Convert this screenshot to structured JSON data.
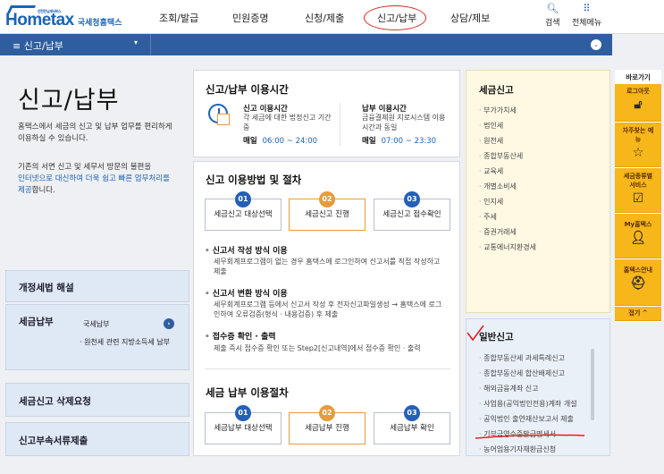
{
  "header": {
    "logo_main": "Hometax",
    "logo_small": "안전한 납세서비스",
    "logo_sub": "국세청홈택스",
    "nav": [
      "조회/발급",
      "민원증명",
      "신청/제출",
      "신고/납부",
      "상담/제보"
    ],
    "search_label": "검색",
    "all_menu_label": "전체메뉴"
  },
  "navstrip": {
    "menu_label": "≡  신고/납부"
  },
  "left": {
    "title": "신고/납부",
    "desc1": "홈택스에서 세금의 신고 및 납부 업무를 편리하게 이용하실 수 있습니다.",
    "desc2_pre": "기존의 서면 신고 및 세무서 방문의 불편을",
    "desc2_link": "인터넷으로 대신하여 더욱 쉽고 빠른 업무처리를 제공",
    "desc2_post": "합니다.",
    "boxes": {
      "tax_law": "개정세법 해설",
      "tax_payment": "세금납부",
      "national_tax_payment": "국세납부",
      "withholding_local_tax": "· 원천세 관련 지방소득세 납부",
      "delete_request": "세금신고 삭제요청",
      "attach_docs": "신고부속서류제출"
    }
  },
  "usage_time": {
    "title": "신고/납부 이용시간",
    "filing_title": "신고 이용시간",
    "filing_desc": "각 세금에 대한 법정신고 기간 중",
    "filing_daily": "매일",
    "filing_time": "06:00 ~ 24:00",
    "payment_title": "납부 이용시간",
    "payment_desc": "금융결제원 지로시스템 이용시간과 동일",
    "payment_daily": "매일",
    "payment_time": "07:00 ~ 23:30"
  },
  "filing_method": {
    "title": "신고 이용방법 및 절차",
    "steps": [
      {
        "num": "01",
        "label": "세금신고 대상선택"
      },
      {
        "num": "02",
        "label": "세금신고 진행"
      },
      {
        "num": "03",
        "label": "세금신고 접수확인"
      }
    ],
    "bullets": [
      {
        "title": "신고서 작성 방식 이용",
        "desc": "세무회계프로그램이 없는 경우 홈택스에 로그인하여 신고서를 직접 작성하고 제출"
      },
      {
        "title": "신고서 변환 방식 이용",
        "desc": "세무회계프로그램 등에서 신고서 작성 후 전자신고파일생성 → 홈택스에 로그인하여 오류검증(형식 · 내용검증) 후 제출"
      },
      {
        "title": "접수증 확인 · 출력",
        "desc": "제출 즉시 접수증 확인 또는 Step2[신고내역]에서 접수증 확인 · 출력"
      }
    ]
  },
  "payment_process": {
    "title": "세금 납부 이용절차",
    "steps": [
      {
        "num": "01",
        "label": "세금납부 대상선택"
      },
      {
        "num": "02",
        "label": "세금납부 진행"
      },
      {
        "num": "03",
        "label": "세금납부 확인"
      }
    ]
  },
  "tax_filing": {
    "title": "세금신고",
    "items": [
      "부가가치세",
      "법인세",
      "원천세",
      "종합부동산세",
      "교육세",
      "개별소비세",
      "인지세",
      "주세",
      "증권거래세",
      "교통에너지환경세"
    ]
  },
  "general_filing": {
    "title": "일반신고",
    "items": [
      "종합부동산세 과세특례신고",
      "종합부동산세 합산배제신고",
      "해외금융계좌 신고",
      "사업용(공익법인전용)계좌 개설",
      "공익법인 출연재산보고서 제출",
      "기부금영수증발급명세서",
      "농어업용기자재환급신청"
    ]
  },
  "quick": {
    "title": "바로가기",
    "items": [
      {
        "label": "로그아웃",
        "icon": "unlock-icon"
      },
      {
        "label": "자주찾는 메뉴",
        "icon": "star-icon"
      },
      {
        "label": "세금종류별 서비스",
        "icon": "checkbox-icon"
      },
      {
        "label": "My홈택스",
        "icon": "user-icon"
      },
      {
        "label": "홈택스안내",
        "icon": "helmet-icon"
      },
      {
        "label": "접기 ^",
        "icon": ""
      }
    ]
  },
  "colors": {
    "brand": "#1b63b5",
    "nav_bg": "#2f5e9e",
    "accent_orange": "#e89b3c",
    "step_blue": "#2460b6",
    "quick_yellow": "#f7b619",
    "annotation_red": "#e02020"
  }
}
